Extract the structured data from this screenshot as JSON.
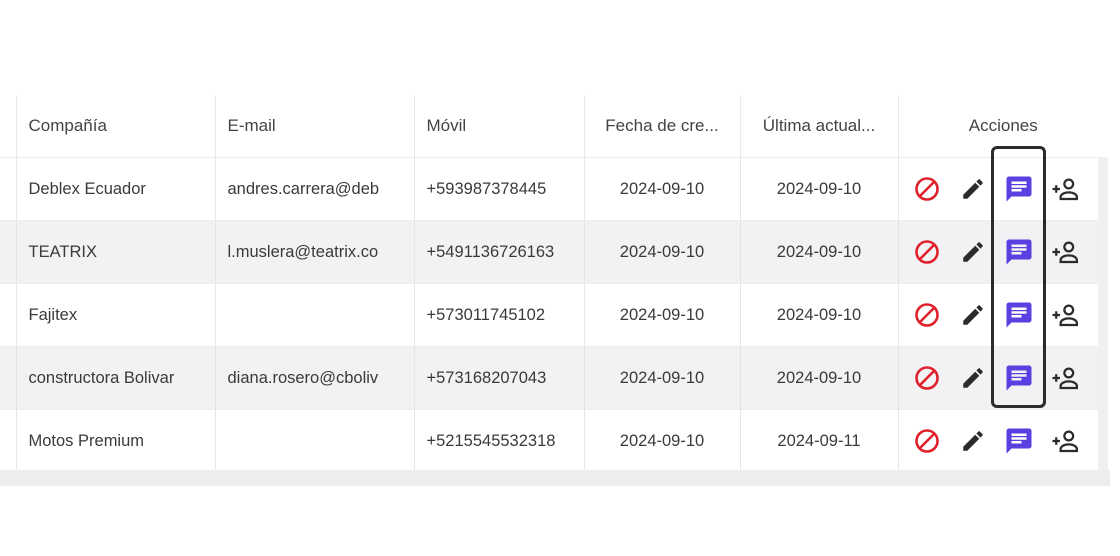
{
  "table": {
    "headers": [
      "Compañía",
      "E-mail",
      "Móvil",
      "Fecha de cre...",
      "Última actual...",
      "Acciones"
    ],
    "rows": [
      {
        "company": "Deblex Ecuador",
        "email": "andres.carrera@deb",
        "mobile": "+593987378445",
        "created": "2024-09-10",
        "updated": "2024-09-10"
      },
      {
        "company": "TEATRIX",
        "email": "l.muslera@teatrix.co",
        "mobile": "+5491136726163",
        "created": "2024-09-10",
        "updated": "2024-09-10"
      },
      {
        "company": "Fajitex",
        "email": "",
        "mobile": "+573011745102",
        "created": "2024-09-10",
        "updated": "2024-09-10"
      },
      {
        "company": "constructora Bolivar",
        "email": "diana.rosero@cboliv",
        "mobile": "+573168207043",
        "created": "2024-09-10",
        "updated": "2024-09-10"
      },
      {
        "company": "Motos Premium",
        "email": "",
        "mobile": "+5215545532318",
        "created": "2024-09-10",
        "updated": "2024-09-11"
      }
    ]
  },
  "icons": {
    "block": "block-icon",
    "edit": "pencil-icon",
    "message": "message-icon",
    "add_user": "add-person-icon"
  },
  "colors": {
    "block": "#e0202b",
    "edit": "#2b2b2b",
    "message": "#5b3fe0",
    "add_user": "#2b2b2b",
    "row_alt": "#f2f2f5"
  }
}
